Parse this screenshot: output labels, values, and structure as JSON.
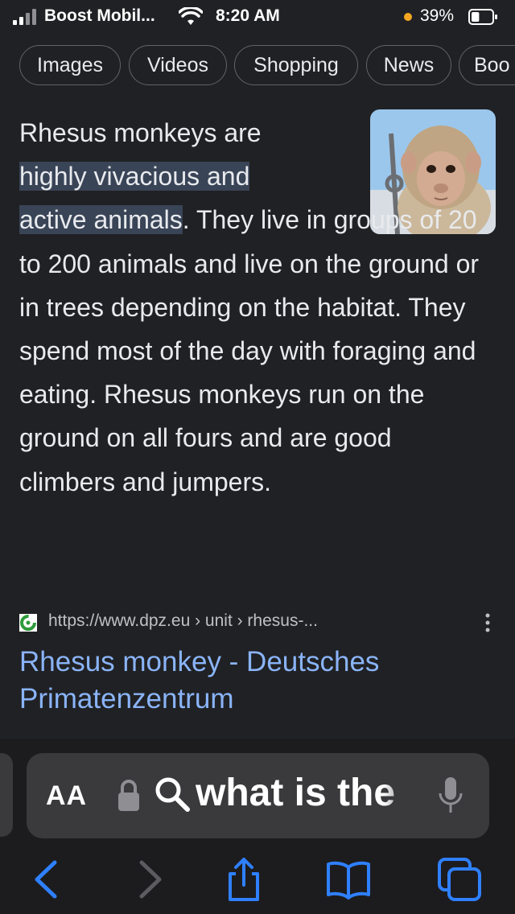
{
  "status_bar": {
    "carrier": "Boost Mobil...",
    "time": "8:20 AM",
    "battery_percent": "39%",
    "battery_level": 0.39,
    "icons": [
      "signal-icon",
      "wifi-icon",
      "location-dot-icon",
      "battery-icon"
    ]
  },
  "chips": [
    {
      "label": "Images"
    },
    {
      "label": "Videos"
    },
    {
      "label": "Shopping"
    },
    {
      "label": "News"
    },
    {
      "label": "Boo"
    }
  ],
  "answer": {
    "lead": "Rhesus monkeys are ",
    "highlight_1": "highly vivacious and",
    "highlight_2": "active animals",
    "body": ". They live in groups of 20 to 200 animals and live on the ground or in trees depending on the habitat. They spend most of the day with foraging and eating. Rhesus monkeys run on the ground on all fours and are good climbers and jumpers.",
    "image": "rhesus-monkey-photo"
  },
  "source": {
    "url": "https://www.dpz.eu › unit › rhesus-...",
    "title": "Rhesus monkey - Deutsches Primatenzentrum",
    "favicon": "dpz-favicon-icon"
  },
  "address_bar": {
    "text_size_label": "AA",
    "query": "what is the",
    "icons": [
      "lock-icon",
      "search-icon",
      "microphone-icon"
    ]
  },
  "toolbar": {
    "icons": [
      "back-icon",
      "forward-icon",
      "share-icon",
      "bookmarks-icon",
      "tabs-icon"
    ]
  },
  "colors": {
    "background": "#202124",
    "link": "#8ab4f8",
    "highlight": "#394457",
    "ios_blue": "#2f80ff"
  }
}
